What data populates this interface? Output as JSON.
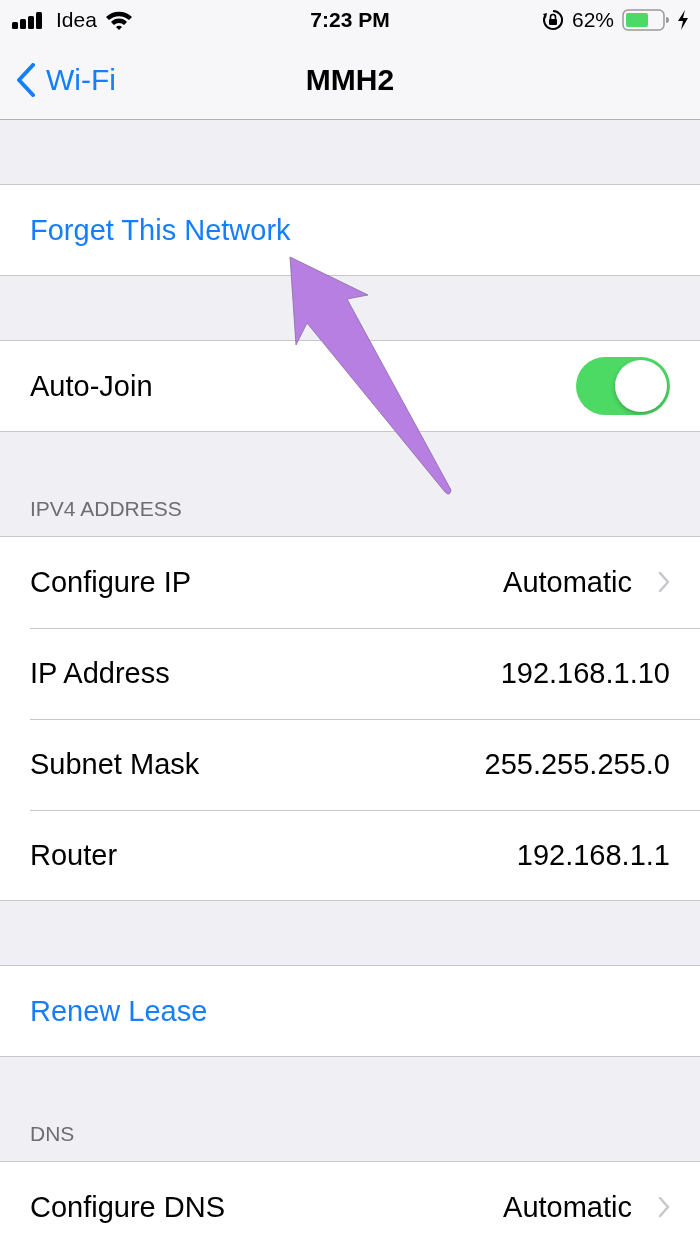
{
  "status_bar": {
    "carrier": "Idea",
    "time": "7:23 PM",
    "battery_percent": "62%"
  },
  "nav": {
    "back_label": "Wi-Fi",
    "title": "MMH2"
  },
  "sections": [
    {
      "rows": [
        {
          "kind": "action",
          "label": "Forget This Network"
        }
      ]
    },
    {
      "rows": [
        {
          "kind": "toggle",
          "label": "Auto-Join",
          "on": true
        }
      ]
    },
    {
      "header": "IPV4 ADDRESS",
      "rows": [
        {
          "kind": "value",
          "label": "Configure IP",
          "value": "Automatic",
          "chevron": true
        },
        {
          "kind": "value",
          "label": "IP Address",
          "value": "192.168.1.10",
          "chevron": false
        },
        {
          "kind": "value",
          "label": "Subnet Mask",
          "value": "255.255.255.0",
          "chevron": false
        },
        {
          "kind": "value",
          "label": "Router",
          "value": "192.168.1.1",
          "chevron": false
        }
      ]
    },
    {
      "rows": [
        {
          "kind": "action",
          "label": "Renew Lease"
        }
      ]
    },
    {
      "header": "DNS",
      "rows": [
        {
          "kind": "value",
          "label": "Configure DNS",
          "value": "Automatic",
          "chevron": true
        }
      ]
    }
  ]
}
